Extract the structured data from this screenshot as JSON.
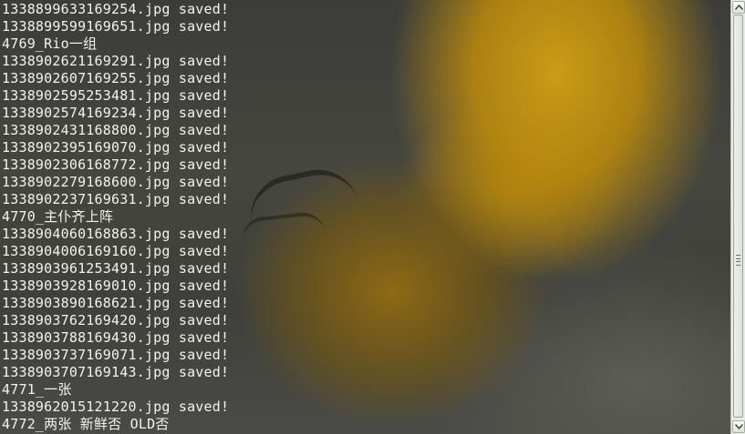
{
  "terminal": {
    "lines": [
      "1338899633169254.jpg saved!",
      "1338899599169651.jpg saved!",
      "4769_Rio一组",
      "1338902621169291.jpg saved!",
      "1338902607169255.jpg saved!",
      "1338902595253481.jpg saved!",
      "1338902574169234.jpg saved!",
      "1338902431168800.jpg saved!",
      "1338902395169070.jpg saved!",
      "1338902306168772.jpg saved!",
      "1338902279168600.jpg saved!",
      "1338902237169631.jpg saved!",
      "4770_主仆齐上阵",
      "1338904060168863.jpg saved!",
      "1338904006169160.jpg saved!",
      "1338903961253491.jpg saved!",
      "1338903928169010.jpg saved!",
      "1338903890168621.jpg saved!",
      "1338903762169420.jpg saved!",
      "1338903788169430.jpg saved!",
      "1338903737169071.jpg saved!",
      "1338903707169143.jpg saved!",
      "4771_一张",
      "1338962015121220.jpg saved!",
      "4772_两张 新鲜否 OLD否"
    ],
    "text_color": "#f2f2ee"
  },
  "scrollbar": {
    "up_icon": "arrow-up-icon",
    "down_icon": "arrow-down-icon",
    "position_fraction": 0.97
  }
}
